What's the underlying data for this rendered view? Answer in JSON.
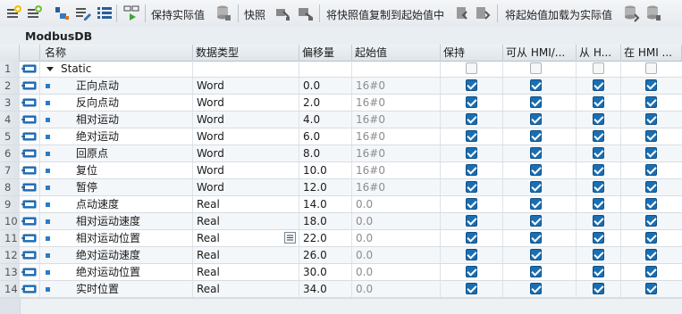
{
  "toolbar": {
    "keep_actual": "保持实际值",
    "snapshot": "快照",
    "copy_snapshot_to_start": "将快照值复制到起始值中",
    "load_start_as_actual": "将起始值加载为实际值"
  },
  "db_title": "ModbusDB",
  "columns": {
    "name": "名称",
    "datatype": "数据类型",
    "offset": "偏移量",
    "start": "起始值",
    "retain": "保持",
    "hmi_access": "可从 HMI/...",
    "hmi_from": "从 H...",
    "hmi_in": "在 HMI ..."
  },
  "rows": [
    {
      "no": "1",
      "name": "Static",
      "type": "",
      "offset": "",
      "start": "",
      "retain": false,
      "hmi1": false,
      "hmi2": false,
      "hmi3": false
    },
    {
      "no": "2",
      "name": "正向点动",
      "type": "Word",
      "offset": "0.0",
      "start": "16#0",
      "retain": true,
      "hmi1": true,
      "hmi2": true,
      "hmi3": true
    },
    {
      "no": "3",
      "name": "反向点动",
      "type": "Word",
      "offset": "2.0",
      "start": "16#0",
      "retain": true,
      "hmi1": true,
      "hmi2": true,
      "hmi3": true
    },
    {
      "no": "4",
      "name": "相对运动",
      "type": "Word",
      "offset": "4.0",
      "start": "16#0",
      "retain": true,
      "hmi1": true,
      "hmi2": true,
      "hmi3": true
    },
    {
      "no": "5",
      "name": "绝对运动",
      "type": "Word",
      "offset": "6.0",
      "start": "16#0",
      "retain": true,
      "hmi1": true,
      "hmi2": true,
      "hmi3": true
    },
    {
      "no": "6",
      "name": "回原点",
      "type": "Word",
      "offset": "8.0",
      "start": "16#0",
      "retain": true,
      "hmi1": true,
      "hmi2": true,
      "hmi3": true
    },
    {
      "no": "7",
      "name": "复位",
      "type": "Word",
      "offset": "10.0",
      "start": "16#0",
      "retain": true,
      "hmi1": true,
      "hmi2": true,
      "hmi3": true
    },
    {
      "no": "8",
      "name": "暂停",
      "type": "Word",
      "offset": "12.0",
      "start": "16#0",
      "retain": true,
      "hmi1": true,
      "hmi2": true,
      "hmi3": true
    },
    {
      "no": "9",
      "name": "点动速度",
      "type": "Real",
      "offset": "14.0",
      "start": "0.0",
      "retain": true,
      "hmi1": true,
      "hmi2": true,
      "hmi3": true
    },
    {
      "no": "10",
      "name": "相对运动速度",
      "type": "Real",
      "offset": "18.0",
      "start": "0.0",
      "retain": true,
      "hmi1": true,
      "hmi2": true,
      "hmi3": true
    },
    {
      "no": "11",
      "name": "相对运动位置",
      "type": "Real",
      "offset": "22.0",
      "start": "0.0",
      "retain": true,
      "hmi1": true,
      "hmi2": true,
      "hmi3": true
    },
    {
      "no": "12",
      "name": "绝对运动速度",
      "type": "Real",
      "offset": "26.0",
      "start": "0.0",
      "retain": true,
      "hmi1": true,
      "hmi2": true,
      "hmi3": true
    },
    {
      "no": "13",
      "name": "绝对运动位置",
      "type": "Real",
      "offset": "30.0",
      "start": "0.0",
      "retain": true,
      "hmi1": true,
      "hmi2": true,
      "hmi3": true
    },
    {
      "no": "14",
      "name": "实时位置",
      "type": "Real",
      "offset": "34.0",
      "start": "0.0",
      "retain": true,
      "hmi1": true,
      "hmi2": true,
      "hmi3": true
    }
  ],
  "colors": {
    "accent": "#1a6fb3",
    "icon_blue": "#2a7bc8",
    "icon_green": "#4aa33a"
  }
}
